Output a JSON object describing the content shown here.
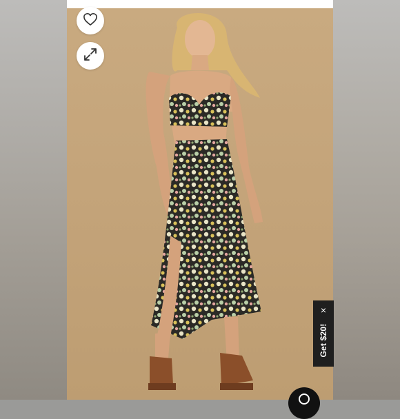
{
  "product_view": {
    "favorite_icon": "heart-icon",
    "expand_icon": "expand-arrows-icon",
    "search_icon": "magnifier-icon"
  },
  "promo": {
    "label": "Get $20!",
    "close": "×"
  },
  "colors": {
    "backdrop": "#c4a47a",
    "promo_bg": "#1f1f1f",
    "button_bg": "#ffffff"
  }
}
